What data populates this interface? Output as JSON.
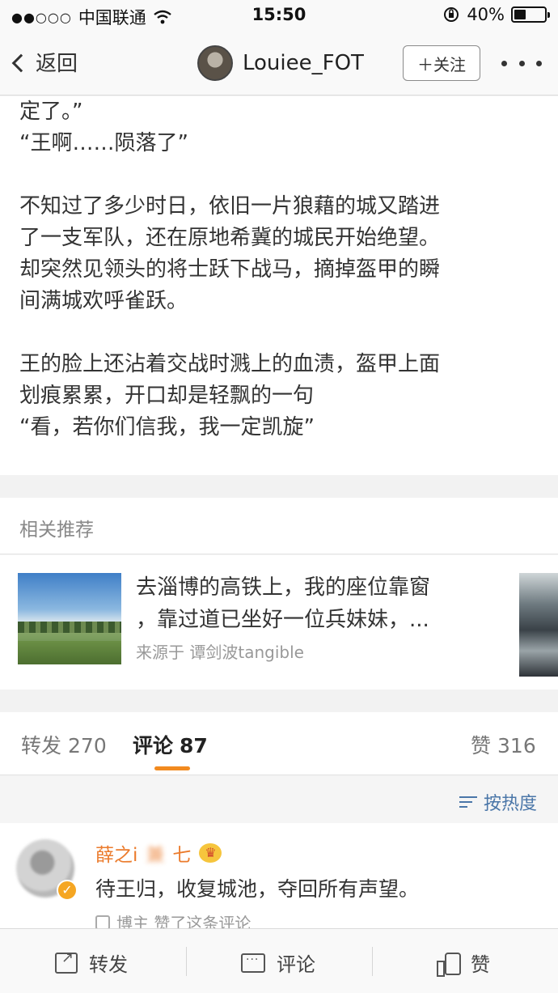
{
  "status_bar": {
    "signal": "●●○○○",
    "carrier": "中国联通",
    "time": "15:50",
    "battery_text": "40%",
    "battery_level": 0.4
  },
  "nav": {
    "back_label": "返回",
    "title": "Louiee_FOT",
    "follow_label": "＋关注"
  },
  "article": {
    "lines": [
      "定了。”",
      "“王啊……陨落了”",
      "",
      "不知过了多少时日，依旧一片狼藉的城又踏进",
      "了一支军队，还在原地希冀的城民开始绝望。",
      "却突然见领头的将士跃下战马，摘掉盔甲的瞬",
      "间满城欢呼雀跃。",
      "",
      "王的脸上还沾着交战时溅上的血渍，盔甲上面",
      "划痕累累，开口却是轻飘的一句",
      "“看，若你们信我，我一定凯旋”"
    ]
  },
  "related": {
    "title": "相关推荐",
    "card": {
      "line1": "去淄博的高铁上，我的座位靠窗",
      "line2": "，靠过道已坐好一位兵妹妹，...",
      "source": "来源于 谭剑波tangible"
    }
  },
  "stats": {
    "repost_label": "转发",
    "repost_count": "270",
    "comment_label": "评论",
    "comment_count": "87",
    "like_label": "赞",
    "like_count": "316"
  },
  "sort": {
    "label": "按热度"
  },
  "comment": {
    "name": "薛之i",
    "tag": "兼",
    "tag_suffix": "七",
    "text": "待王归，收复城池，夺回所有声望。",
    "like_note": "博主 赞了这条评论"
  },
  "toolbar": {
    "repost": "转发",
    "comment": "评论",
    "like": "赞"
  },
  "colors": {
    "accent_orange": "#f28a1f",
    "name_orange": "#eb7b2c",
    "link_blue": "#4a76a8"
  }
}
